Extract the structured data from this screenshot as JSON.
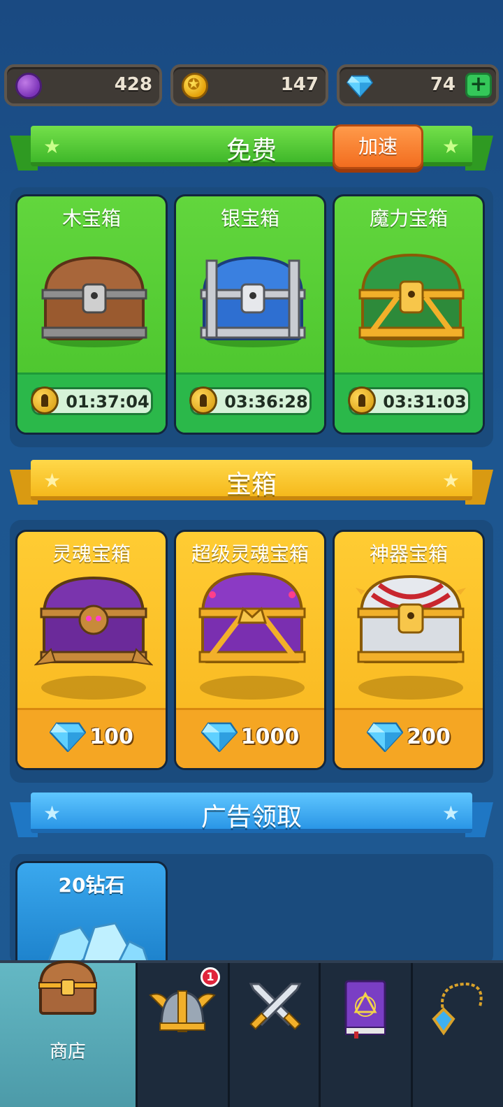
{
  "currency": {
    "purple_amount": "428",
    "gold_amount": "147",
    "diamond_amount": "74",
    "add_label": "+"
  },
  "sections": {
    "free": {
      "title": "免费",
      "speed_button": "加速"
    },
    "chests": {
      "title": "宝箱"
    },
    "ads": {
      "title": "广告领取"
    }
  },
  "free_chests": [
    {
      "name": "木宝箱",
      "timer": "01:37:04"
    },
    {
      "name": "银宝箱",
      "timer": "03:36:28"
    },
    {
      "name": "魔力宝箱",
      "timer": "03:31:03"
    }
  ],
  "paid_chests": [
    {
      "name": "灵魂宝箱",
      "price": "100"
    },
    {
      "name": "超级灵魂宝箱",
      "price": "1000"
    },
    {
      "name": "神器宝箱",
      "price": "200"
    }
  ],
  "ad_rewards": [
    {
      "name": "20钻石"
    }
  ],
  "nav": {
    "shop_label": "商店",
    "heroes_badge": "1",
    "items": [
      "shop-icon",
      "helmet-icon",
      "crossed-swords-icon",
      "spellbook-icon",
      "amulet-icon"
    ]
  },
  "colors": {
    "background": "#1d5690",
    "free_green": "#48c22b",
    "chest_yellow": "#f8b51e",
    "ads_blue": "#2a96e6",
    "speed_orange": "#f26d1f"
  }
}
